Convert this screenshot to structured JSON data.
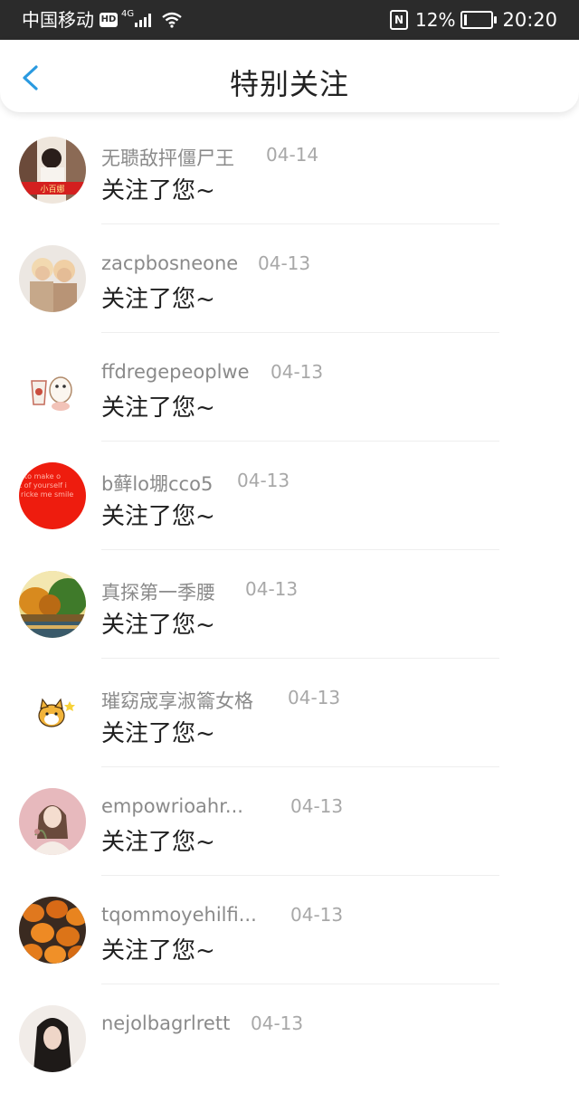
{
  "status_bar": {
    "carrier": "中国移动",
    "hd": "HD",
    "network": "4G",
    "battery_percent": "12%",
    "battery_level": 0.12,
    "time": "20:20"
  },
  "header": {
    "title": "特别关注",
    "back_icon": "chevron-left-icon"
  },
  "colors": {
    "accent": "#2a9ae0",
    "name_text": "#8a8a8a",
    "date_text": "#a8a8a8",
    "message_text": "#1f1f1f"
  },
  "notifications": [
    {
      "name": "无聩敌抨僵尸王",
      "date": "04-14",
      "message": "关注了您~"
    },
    {
      "name": "zacpbosneone",
      "date": "04-13",
      "message": "关注了您~"
    },
    {
      "name": "ffdregepeoplwe",
      "date": "04-13",
      "message": "关注了您~"
    },
    {
      "name": "b藓lo堋cco5",
      "date": "04-13",
      "message": "关注了您~"
    },
    {
      "name": "真探第一季腰",
      "date": "04-13",
      "message": "关注了您~"
    },
    {
      "name": "璀窈宬享淑籥女格",
      "date": "04-13",
      "message": "关注了您~"
    },
    {
      "name": "empowrioahr...",
      "date": "04-13",
      "message": "关注了您~"
    },
    {
      "name": "tqommoyehilfi...",
      "date": "04-13",
      "message": "关注了您~"
    },
    {
      "name": "nejolbagrlrett",
      "date": "04-13",
      "message": ""
    }
  ],
  "avatar_texts": {
    "row0": "小百娜",
    "row3_lines": [
      "to make o",
      "t of yourself i",
      "ricke me smile"
    ]
  }
}
